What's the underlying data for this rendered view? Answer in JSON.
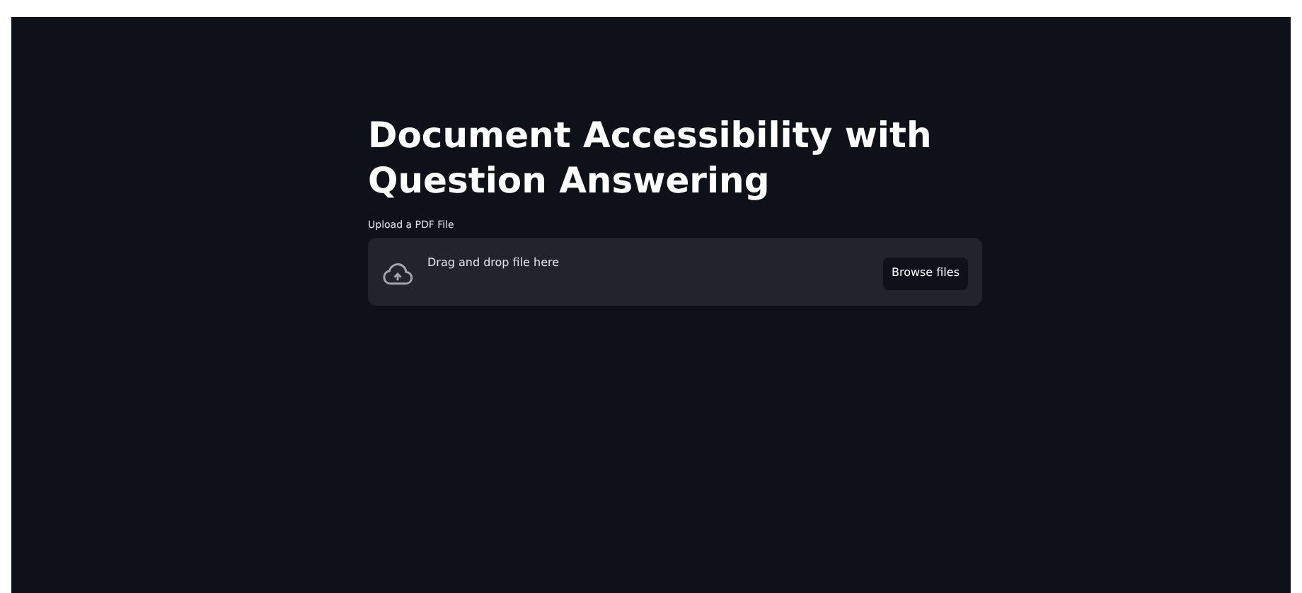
{
  "title": "Document Accessibility with Question Answering",
  "uploader": {
    "label": "Upload a PDF File",
    "instruction": "Drag and drop file here",
    "button": "Browse files"
  }
}
